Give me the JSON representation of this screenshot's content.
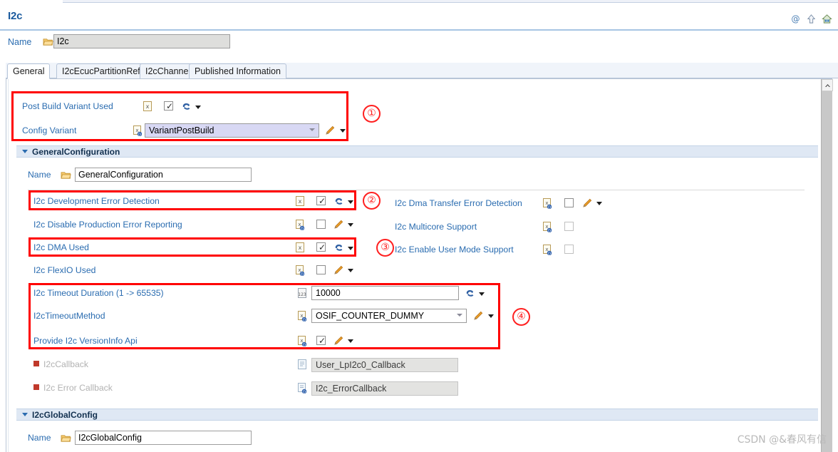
{
  "form": {
    "title": "I2c",
    "header_icons": [
      "at-icon",
      "up-arrow-icon",
      "home-icon"
    ],
    "name_label": "Name",
    "name_value": "I2c"
  },
  "tabs": [
    {
      "label": "General",
      "active": true
    },
    {
      "label": "I2cEcucPartitionRef",
      "active": false
    },
    {
      "label": "I2cChannel",
      "active": false
    },
    {
      "label": "Published Information",
      "active": false
    }
  ],
  "variant_block": {
    "post_build_variant_used": {
      "label": "Post Build Variant Used",
      "checked": true,
      "marker_icon": "x-doc-icon",
      "action_icon": "paint-icon"
    },
    "config_variant": {
      "label": "Config Variant",
      "value": "VariantPostBuild",
      "marker_icon": "d-doc-icon",
      "action_icon": "pencil-icon"
    }
  },
  "general_configuration": {
    "section_title": "GeneralConfiguration",
    "name_label": "Name",
    "name_value": "GeneralConfiguration",
    "left_rows": [
      {
        "label": "I2c Development Error Detection",
        "type": "checkbox",
        "checked": true,
        "marker_icon": "x-doc-icon",
        "action_icon": "paint-icon",
        "dimmed": false
      },
      {
        "label": "I2c Disable Production Error Reporting",
        "type": "checkbox",
        "checked": false,
        "marker_icon": "d-doc-icon",
        "action_icon": "pencil-icon",
        "dimmed": false
      },
      {
        "label": "I2c DMA Used",
        "type": "checkbox",
        "checked": true,
        "marker_icon": "x-doc-icon",
        "action_icon": "paint-icon",
        "dimmed": false
      },
      {
        "label": "I2c FlexIO Used",
        "type": "checkbox",
        "checked": false,
        "marker_icon": "d-doc-icon",
        "action_icon": "pencil-icon",
        "dimmed": false
      }
    ],
    "right_rows": [
      {
        "label": "I2c Dma Transfer Error Detection",
        "type": "checkbox",
        "checked": false,
        "marker_icon": "d-doc-icon",
        "action_icon": "pencil-icon",
        "dimmed": false
      },
      {
        "label": "I2c Multicore Support",
        "type": "checkbox",
        "checked": false,
        "marker_icon": "d-doc-icon",
        "action_icon": "none",
        "dimmed": true
      },
      {
        "label": "I2c Enable User Mode Support",
        "type": "checkbox",
        "checked": false,
        "marker_icon": "d-doc-icon",
        "action_icon": "none",
        "dimmed": true
      }
    ],
    "timeout_rows": [
      {
        "label": "I2c Timeout Duration (1 -> 65535)",
        "type": "text",
        "value": "10000",
        "marker_icon": "num-doc-icon",
        "action_icon": "paint-icon"
      },
      {
        "label": "I2cTimeoutMethod",
        "type": "combo",
        "value": "OSIF_COUNTER_DUMMY",
        "marker_icon": "d-doc-icon",
        "action_icon": "pencil-icon"
      },
      {
        "label": "Provide I2c VersionInfo Api",
        "type": "checkbox",
        "checked": true,
        "marker_icon": "xd-doc-icon",
        "action_icon": "pencil-icon"
      }
    ],
    "callback_rows": [
      {
        "label": "I2cCallback",
        "value": "User_LpI2c0_Callback",
        "marker_icon": "plain-doc-icon",
        "bullet": "red-square-icon"
      },
      {
        "label": "I2c Error Callback",
        "value": "I2c_ErrorCallback",
        "marker_icon": "d-doc-icon",
        "bullet": "red-square-icon"
      }
    ]
  },
  "global_config": {
    "section_title": "I2cGlobalConfig",
    "name_label": "Name",
    "name_value": "I2cGlobalConfig"
  },
  "annotations": [
    {
      "num": "①"
    },
    {
      "num": "②"
    },
    {
      "num": "③"
    },
    {
      "num": "④"
    }
  ],
  "watermark": "CSDN @&春风有信",
  "colors": {
    "label_blue": "#2a6cb0",
    "title_blue": "#1a5a9e",
    "annotation_red": "#ff0000",
    "section_band": "#dfe8f4",
    "combo_lilac": "#d8d8f4"
  }
}
